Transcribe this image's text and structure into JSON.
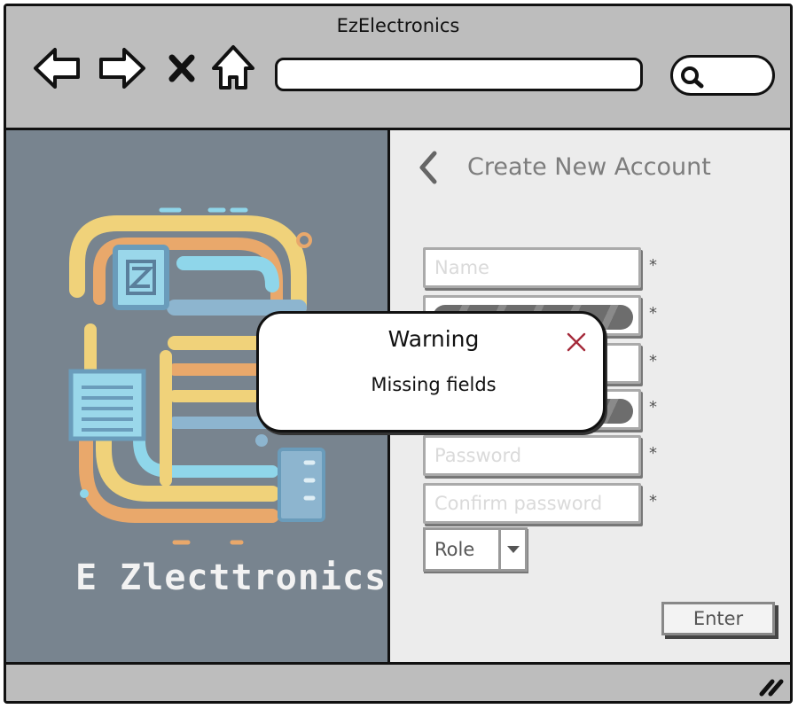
{
  "window": {
    "title": "EzElectronics"
  },
  "browser": {
    "back_icon": "arrow-left-icon",
    "forward_icon": "arrow-right-icon",
    "stop_icon": "close-icon",
    "home_icon": "home-icon",
    "address": "",
    "search_icon": "search-icon"
  },
  "logo": {
    "text": "E Zlecttronics",
    "image": "ez-electronics-logo"
  },
  "form": {
    "title": "Create New Account",
    "back_icon": "chevron-left-icon",
    "fields": [
      {
        "placeholder": "Name",
        "value": "",
        "required": "*",
        "obscured": false
      },
      {
        "placeholder": "",
        "value": "",
        "required": "*",
        "obscured": true
      },
      {
        "placeholder": "",
        "value": "",
        "required": "*",
        "obscured": false
      },
      {
        "placeholder": "",
        "value": "",
        "required": "*",
        "obscured": true
      },
      {
        "placeholder": "Password",
        "value": "",
        "required": "*",
        "obscured": false
      },
      {
        "placeholder": "Confirm password",
        "value": "",
        "required": "*",
        "obscured": false
      }
    ],
    "role": {
      "label": "Role",
      "icon": "chevron-down-icon"
    },
    "submit_label": "Enter"
  },
  "dialog": {
    "title": "Warning",
    "message": "Missing fields",
    "close_icon": "close-icon"
  },
  "colors": {
    "left_panel": "#78848f",
    "right_panel": "#ececec",
    "chrome": "#bdbdbd",
    "close_x": "#a52a3a"
  }
}
